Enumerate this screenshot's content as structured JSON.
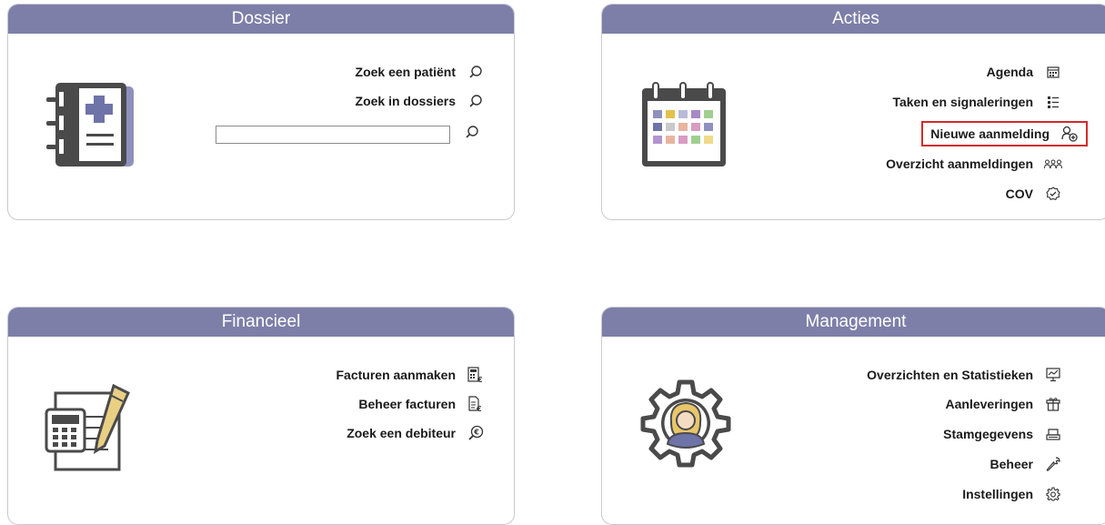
{
  "panels": {
    "dossier": {
      "title": "Dossier",
      "links": [
        "Zoek een patiënt",
        "Zoek in dossiers"
      ],
      "search": {
        "value": "",
        "placeholder": ""
      }
    },
    "acties": {
      "title": "Acties",
      "links": [
        "Agenda",
        "Taken en signaleringen",
        "Nieuwe aanmelding",
        "Overzicht aanmeldingen",
        "COV"
      ],
      "highlighted": "Nieuwe aanmelding"
    },
    "financieel": {
      "title": "Financieel",
      "links": [
        "Facturen aanmaken",
        "Beheer facturen",
        "Zoek een debiteur"
      ]
    },
    "management": {
      "title": "Management",
      "links": [
        "Overzichten en Statistieken",
        "Aanleveringen",
        "Stamgegevens",
        "Beheer",
        "Instellingen"
      ]
    }
  },
  "colors": {
    "header": "#7d7fa8",
    "highlight_border": "#d42a2a",
    "icon_dark": "#4a4a4a",
    "icon_accent": "#6e73a8"
  },
  "icons": {
    "dossier": [
      "search-icon",
      "search-icon",
      "search-icon"
    ],
    "acties": [
      "calendar-icon",
      "task-list-icon",
      "add-person-icon",
      "people-icon",
      "check-badge-icon"
    ],
    "financieel": [
      "invoice-euro-icon",
      "invoice-edit-icon",
      "search-euro-icon"
    ],
    "management": [
      "chart-monitor-icon",
      "gift-icon",
      "card-reader-icon",
      "wrench-icon",
      "gear-icon"
    ]
  }
}
